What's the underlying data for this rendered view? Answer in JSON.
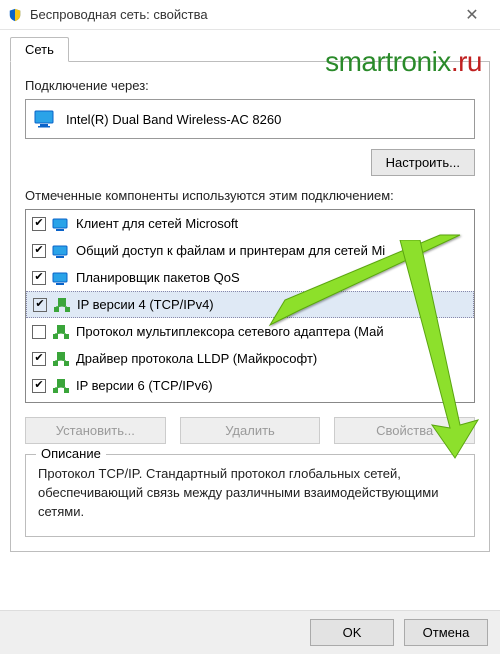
{
  "window": {
    "title": "Беспроводная сеть: свойства",
    "close_glyph": "✕"
  },
  "watermark": {
    "part1": "smartronix",
    "part2": ".ru"
  },
  "tab": {
    "label": "Сеть"
  },
  "connect_via": {
    "label": "Подключение через:",
    "adapter": "Intel(R) Dual Band Wireless-AC 8260"
  },
  "configure_btn": "Настроить...",
  "components_label": "Отмеченные компоненты используются этим подключением:",
  "components": [
    {
      "checked": true,
      "icon": "net-blue",
      "label": "Клиент для сетей Microsoft"
    },
    {
      "checked": true,
      "icon": "net-blue",
      "label": "Общий доступ к файлам и принтерам для сетей Mi"
    },
    {
      "checked": true,
      "icon": "net-blue",
      "label": "Планировщик пакетов QoS"
    },
    {
      "checked": true,
      "icon": "net-green",
      "label": "IP версии 4 (TCP/IPv4)",
      "selected": true
    },
    {
      "checked": false,
      "icon": "net-green",
      "label": "Протокол мультиплексора сетевого адаптера (Май"
    },
    {
      "checked": true,
      "icon": "net-green",
      "label": "Драйвер протокола LLDP (Майкрософт)"
    },
    {
      "checked": true,
      "icon": "net-green",
      "label": "IP версии 6 (TCP/IPv6)"
    }
  ],
  "buttons": {
    "install": "Установить...",
    "remove": "Удалить",
    "properties": "Свойства"
  },
  "description": {
    "legend": "Описание",
    "text": "Протокол TCP/IP. Стандартный протокол глобальных сетей, обеспечивающий связь между различными взаимодействующими сетями."
  },
  "footer": {
    "ok": "OK",
    "cancel": "Отмена"
  }
}
